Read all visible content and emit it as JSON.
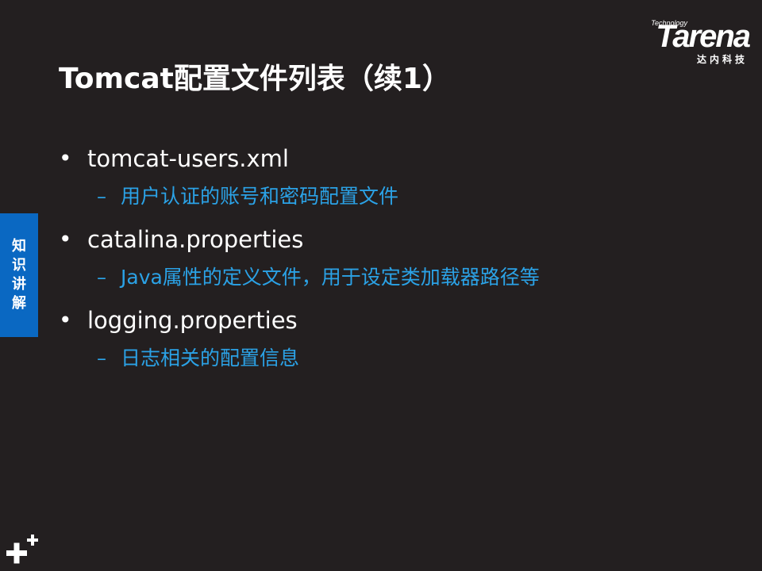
{
  "logo": {
    "tagline": "Technology",
    "name": "Tarena",
    "subtitle": "达内科技"
  },
  "slide": {
    "title": "Tomcat配置文件列表（续1）",
    "side_tab": "知识讲解",
    "items": [
      {
        "text": "tomcat-users.xml",
        "sub": "用户认证的账号和密码配置文件"
      },
      {
        "text": "catalina.properties",
        "sub": "Java属性的定义文件，用于设定类加载器路径等"
      },
      {
        "text": "logging.properties",
        "sub": "日志相关的配置信息"
      }
    ],
    "bullet_symbol": "•",
    "sub_symbol": "–"
  },
  "colors": {
    "background": "#231f20",
    "accent_blue": "#0a68c2",
    "sub_text": "#2ba2e6",
    "text": "#ffffff"
  },
  "icons": {
    "corner": "plus-plus-icon"
  }
}
